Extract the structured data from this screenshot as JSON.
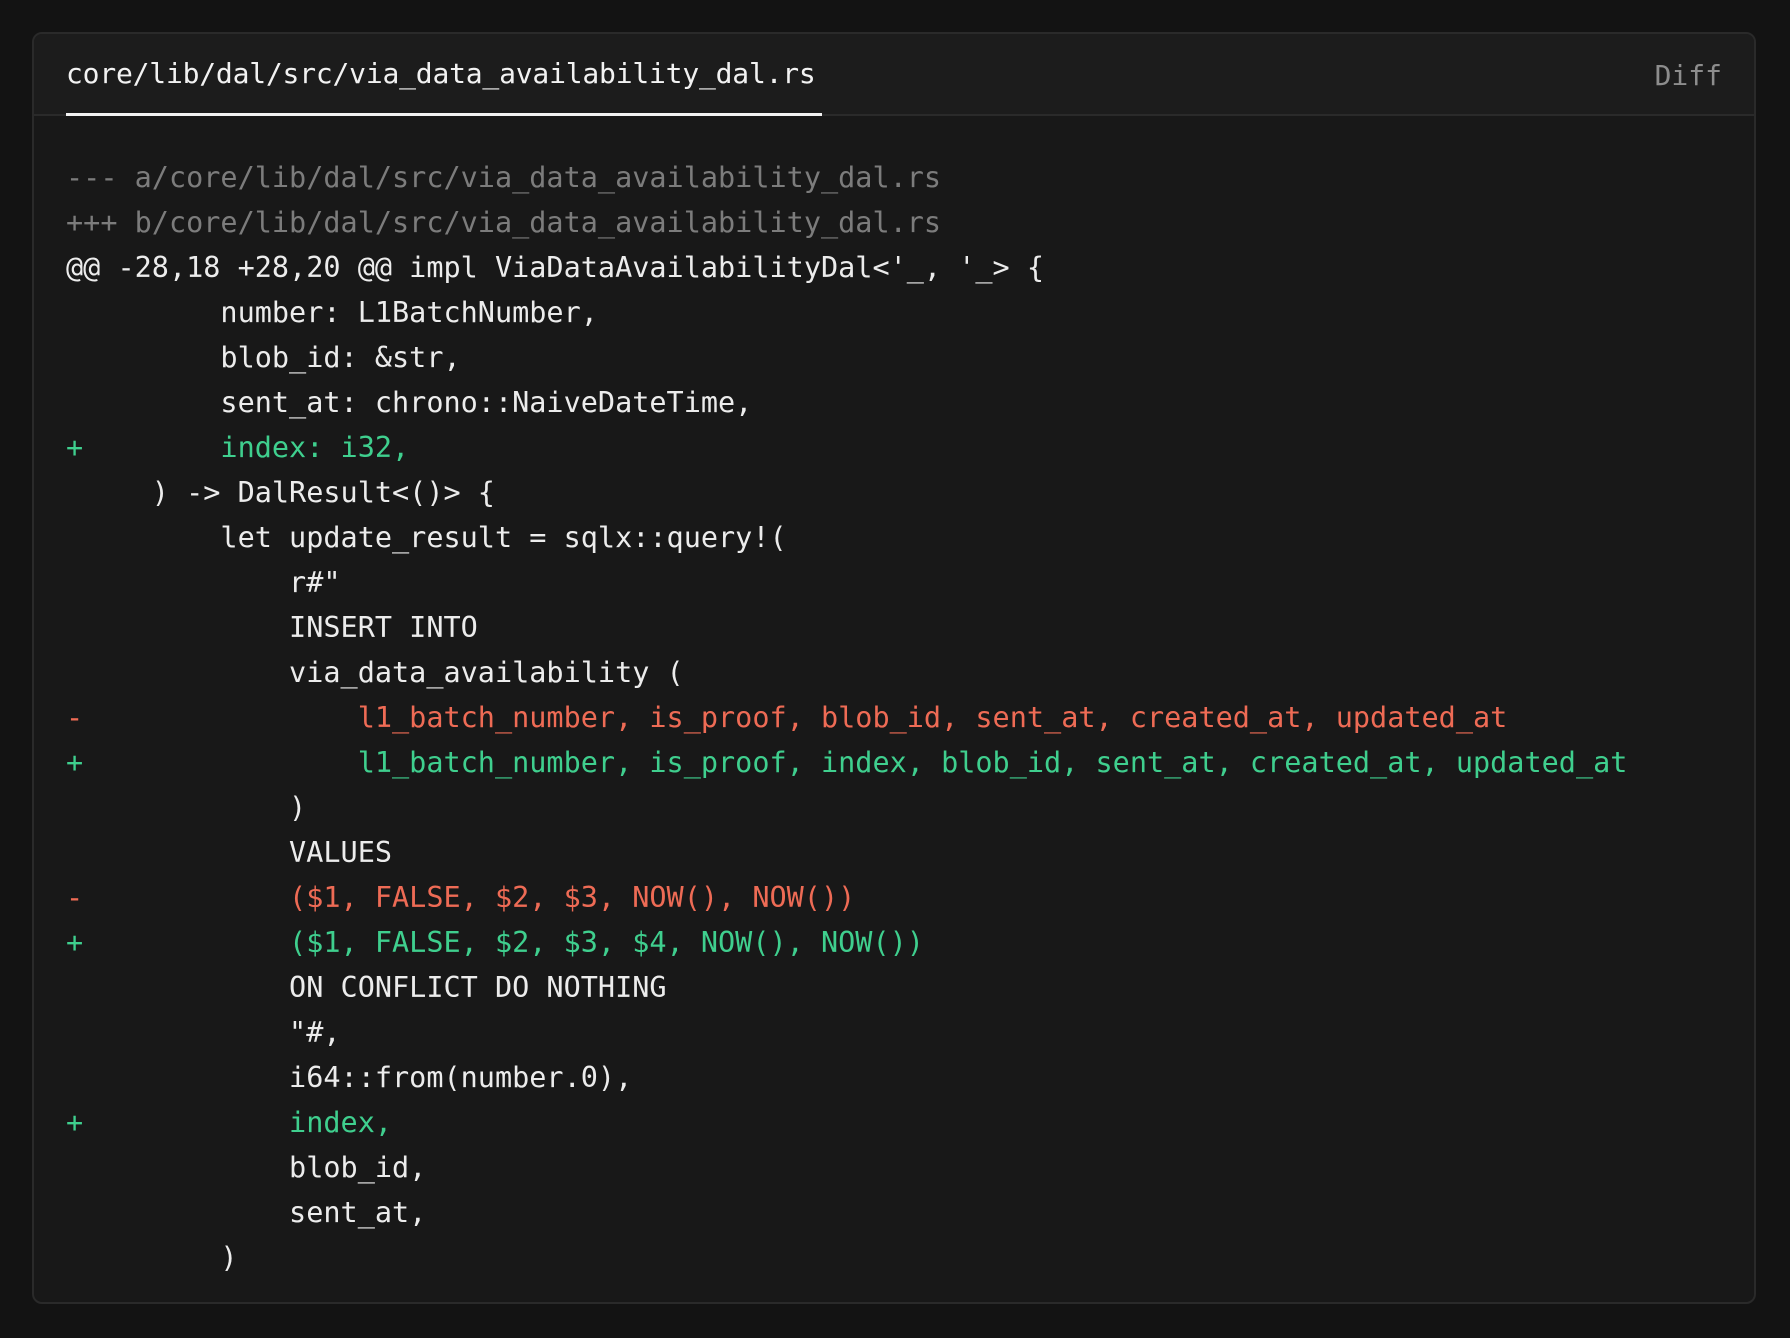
{
  "file_tab": {
    "filename": "core/lib/dal/src/via_data_availability_dal.rs",
    "language": "Diff"
  },
  "colors": {
    "background": "#131313",
    "panel": "#181818",
    "added": "#3fcf8e",
    "removed": "#ee6b55",
    "meta": "#7c7c7c",
    "context": "#ececec"
  },
  "diff_lines": [
    {
      "type": "meta",
      "marker": "",
      "text": "--- a/core/lib/dal/src/via_data_availability_dal.rs"
    },
    {
      "type": "meta",
      "marker": "",
      "text": "+++ b/core/lib/dal/src/via_data_availability_dal.rs"
    },
    {
      "type": "hunk",
      "marker": "",
      "text": "@@ -28,18 +28,20 @@ impl ViaDataAvailabilityDal<'_, '_> {"
    },
    {
      "type": "ctx",
      "marker": " ",
      "text": "        number: L1BatchNumber,"
    },
    {
      "type": "ctx",
      "marker": " ",
      "text": "        blob_id: &str,"
    },
    {
      "type": "ctx",
      "marker": " ",
      "text": "        sent_at: chrono::NaiveDateTime,"
    },
    {
      "type": "add",
      "marker": "+",
      "text": "        index: i32,"
    },
    {
      "type": "ctx",
      "marker": " ",
      "text": "    ) -> DalResult<()> {"
    },
    {
      "type": "ctx",
      "marker": " ",
      "text": "        let update_result = sqlx::query!("
    },
    {
      "type": "ctx",
      "marker": " ",
      "text": "            r#\""
    },
    {
      "type": "ctx",
      "marker": " ",
      "text": "            INSERT INTO"
    },
    {
      "type": "ctx",
      "marker": " ",
      "text": "            via_data_availability ("
    },
    {
      "type": "del",
      "marker": "-",
      "text": "                l1_batch_number, is_proof, blob_id, sent_at, created_at, updated_at"
    },
    {
      "type": "add",
      "marker": "+",
      "text": "                l1_batch_number, is_proof, index, blob_id, sent_at, created_at, updated_at"
    },
    {
      "type": "ctx",
      "marker": " ",
      "text": "            )"
    },
    {
      "type": "ctx",
      "marker": " ",
      "text": "            VALUES"
    },
    {
      "type": "del",
      "marker": "-",
      "text": "            ($1, FALSE, $2, $3, NOW(), NOW())"
    },
    {
      "type": "add",
      "marker": "+",
      "text": "            ($1, FALSE, $2, $3, $4, NOW(), NOW())"
    },
    {
      "type": "ctx",
      "marker": " ",
      "text": "            ON CONFLICT DO NOTHING"
    },
    {
      "type": "ctx",
      "marker": " ",
      "text": "            \"#,"
    },
    {
      "type": "ctx",
      "marker": " ",
      "text": "            i64::from(number.0),"
    },
    {
      "type": "add",
      "marker": "+",
      "text": "            index,"
    },
    {
      "type": "ctx",
      "marker": " ",
      "text": "            blob_id,"
    },
    {
      "type": "ctx",
      "marker": " ",
      "text": "            sent_at,"
    },
    {
      "type": "ctx",
      "marker": " ",
      "text": "        )"
    }
  ]
}
